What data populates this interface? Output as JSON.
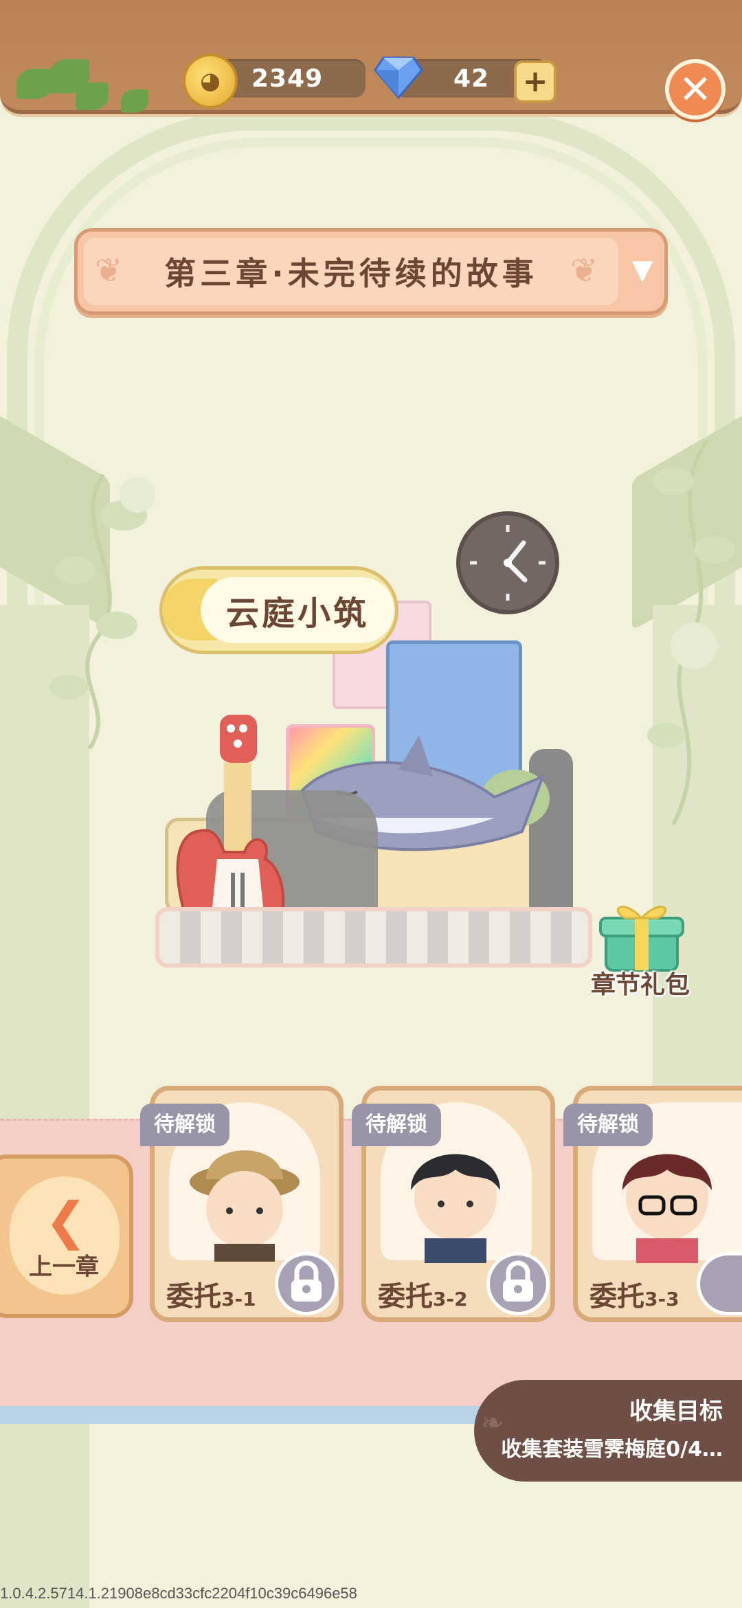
{
  "currency": {
    "coins": "2349",
    "gems": "42"
  },
  "chapter": {
    "title": "第三章·未完待续的故事"
  },
  "room": {
    "name": "云庭小筑"
  },
  "gift": {
    "label": "章节礼包"
  },
  "prev_chapter": {
    "label": "上一章"
  },
  "commissions": [
    {
      "badge": "待解锁",
      "title": "委托",
      "number": "3-1"
    },
    {
      "badge": "待解锁",
      "title": "委托",
      "number": "3-2"
    },
    {
      "badge": "待解锁",
      "title": "委托",
      "number": "3-3"
    }
  ],
  "goal": {
    "title": "收集目标",
    "description": "收集套装雪霁梅庭0/4…"
  },
  "version": "1.0.4.2.5714.1.21908e8cd33cfc2204f10c39c6496e58",
  "colors": {
    "background": "#f3f1dc",
    "accent_orange": "#f08a52",
    "text_brown": "#6c4634",
    "pink_band": "#f3cfc7"
  }
}
